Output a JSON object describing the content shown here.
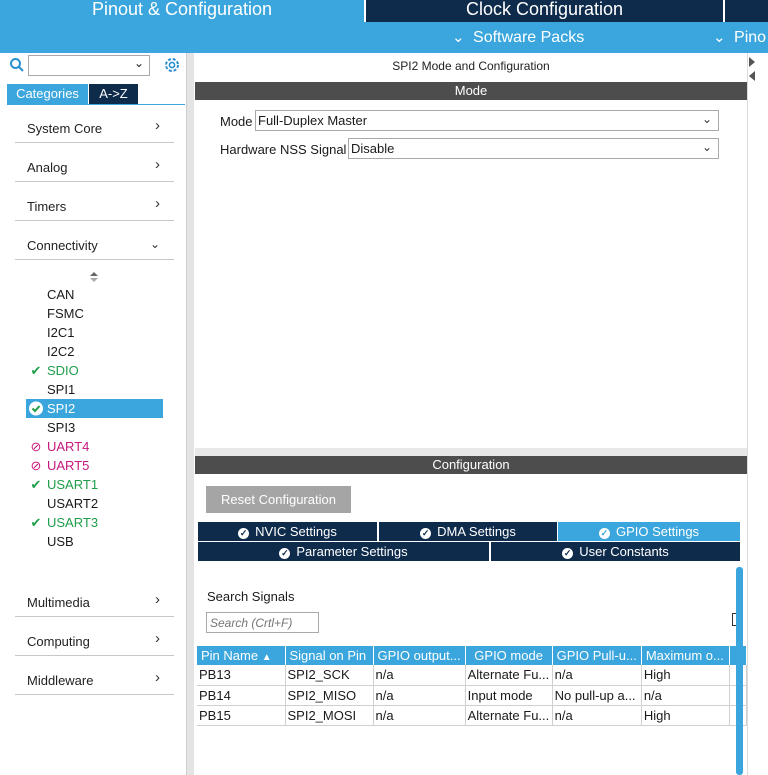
{
  "top_tabs": {
    "pinout": "Pinout & Configuration",
    "clock": "Clock Configuration"
  },
  "subbar": {
    "software_packs": "Software Packs",
    "pinout": "Pino"
  },
  "sidebar": {
    "tabs": {
      "categories": "Categories",
      "az": "A->Z"
    },
    "categories": [
      {
        "label": "System Core"
      },
      {
        "label": "Analog"
      },
      {
        "label": "Timers"
      },
      {
        "label": "Connectivity"
      }
    ],
    "connectivity_items": [
      {
        "label": "CAN",
        "status": "none"
      },
      {
        "label": "FSMC",
        "status": "none"
      },
      {
        "label": "I2C1",
        "status": "none"
      },
      {
        "label": "I2C2",
        "status": "none"
      },
      {
        "label": "SDIO",
        "status": "ok"
      },
      {
        "label": "SPI1",
        "status": "none"
      },
      {
        "label": "SPI2",
        "status": "selected"
      },
      {
        "label": "SPI3",
        "status": "none"
      },
      {
        "label": "UART4",
        "status": "disabled"
      },
      {
        "label": "UART5",
        "status": "disabled"
      },
      {
        "label": "USART1",
        "status": "ok"
      },
      {
        "label": "USART2",
        "status": "none"
      },
      {
        "label": "USART3",
        "status": "ok"
      },
      {
        "label": "USB",
        "status": "none"
      }
    ],
    "bottom_categories": [
      {
        "label": "Multimedia"
      },
      {
        "label": "Computing"
      },
      {
        "label": "Middleware"
      }
    ]
  },
  "mode_panel": {
    "title": "SPI2 Mode and Configuration",
    "section": "Mode",
    "mode_label": "Mode",
    "mode_value": "Full-Duplex Master",
    "nss_label": "Hardware NSS Signal",
    "nss_value": "Disable"
  },
  "config_panel": {
    "section": "Configuration",
    "reset_button": "Reset Configuration",
    "tabs_row1": [
      "NVIC Settings",
      "DMA Settings",
      "GPIO Settings"
    ],
    "tabs_row2": [
      "Parameter Settings",
      "User Constants"
    ],
    "search_label": "Search Signals",
    "search_placeholder": "Search (Crtl+F)"
  },
  "signals_table": {
    "headers": [
      "Pin Name",
      "Signal on Pin",
      "GPIO output...",
      "GPIO mode",
      "GPIO Pull-u...",
      "Maximum o..."
    ],
    "rows": [
      [
        "PB13",
        "SPI2_SCK",
        "n/a",
        "Alternate Fu...",
        "n/a",
        "High"
      ],
      [
        "PB14",
        "SPI2_MISO",
        "n/a",
        "Input mode",
        "No pull-up a...",
        "n/a"
      ],
      [
        "PB15",
        "SPI2_MOSI",
        "n/a",
        "Alternate Fu...",
        "n/a",
        "High"
      ]
    ]
  },
  "colors": {
    "navy": "#0e2b4c",
    "accent_blue": "#3aa6dd",
    "header_grey": "#4d4d4d",
    "ok_green": "#1e9e4a",
    "disabled_magenta": "#c7177e"
  }
}
